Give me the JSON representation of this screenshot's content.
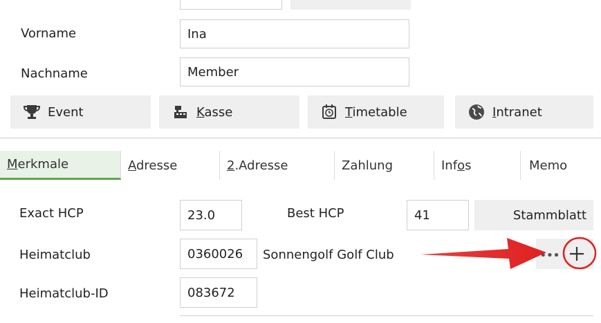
{
  "person": {
    "vorname_label": "Vorname",
    "vorname_value": "Ina",
    "nachname_label": "Nachname",
    "nachname_value": "Member"
  },
  "actions": [
    {
      "pre": "",
      "key": "",
      "post": "Event",
      "icon": "trophy-icon"
    },
    {
      "pre": "",
      "key": "K",
      "post": "asse",
      "icon": "cash-register-icon"
    },
    {
      "pre": "",
      "key": "T",
      "post": "imetable",
      "icon": "clock-icon"
    },
    {
      "pre": "",
      "key": "I",
      "post": "ntranet",
      "icon": "globe-icon"
    }
  ],
  "tabs": [
    {
      "pre": "",
      "key": "M",
      "post": "erkmale",
      "active": true
    },
    {
      "pre": "",
      "key": "A",
      "post": "dresse",
      "active": false
    },
    {
      "pre": "",
      "key": "2",
      "post": ".Adresse",
      "active": false
    },
    {
      "pre": "",
      "key": "",
      "post": "Zahlung",
      "active": false
    },
    {
      "pre": "Inf",
      "key": "o",
      "post": "s",
      "active": false
    },
    {
      "pre": "",
      "key": "",
      "post": "Memo",
      "active": false
    }
  ],
  "details": {
    "exact_hcp_label": "Exact HCP",
    "exact_hcp_value": "23.0",
    "best_hcp_label": "Best HCP",
    "best_hcp_value": "41",
    "stammblatt_label": "Stammblatt",
    "heimatclub_label": "Heimatclub",
    "heimatclub_value": "0360026",
    "heimatclub_name": "Sonnengolf Golf Club",
    "heimatclub_id_label": "Heimatclub-ID",
    "heimatclub_id_value": "083672",
    "more_icon": "ellipsis-icon",
    "add_icon": "plus-icon"
  },
  "colors": {
    "accent_green": "#5aa84a",
    "annotation_red": "#e02020"
  }
}
